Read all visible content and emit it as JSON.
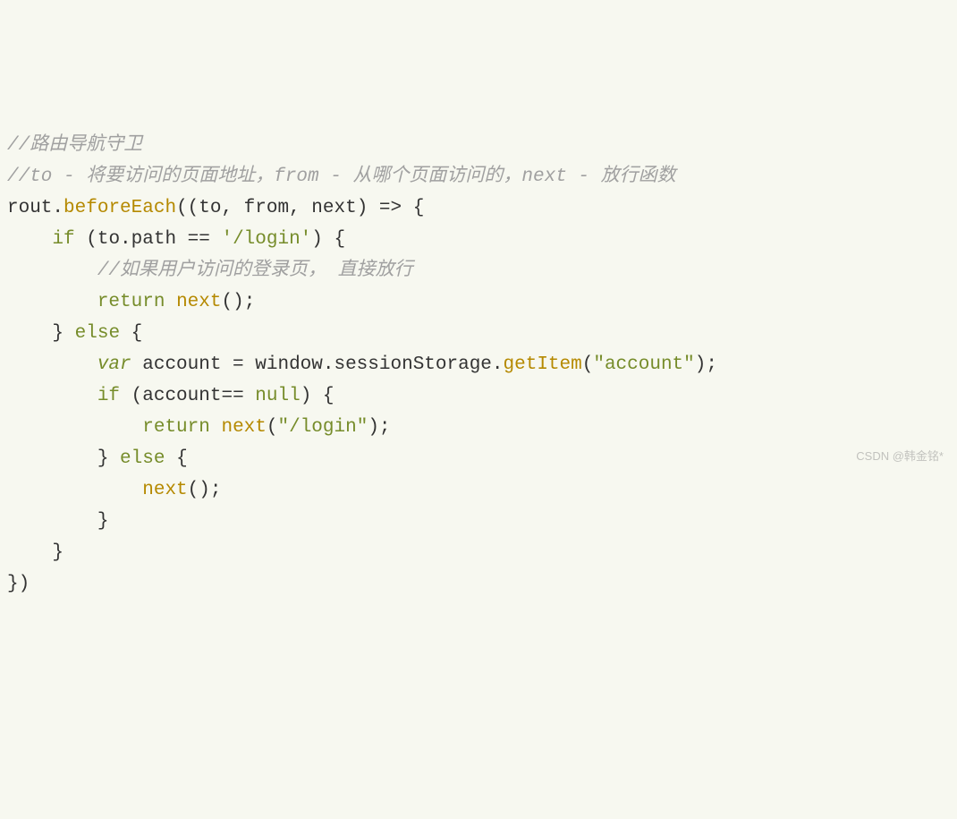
{
  "code": {
    "line1_comment": "//路由导航守卫",
    "line2_comment": "//to - 将要访问的页面地址，from - 从哪个页面访问的，next - 放行函数",
    "line3_obj": "rout",
    "line3_method": "beforeEach",
    "line3_params_open": "((to, from, next) ",
    "line3_arrow": "=>",
    "line3_brace": " {",
    "line4_indent": "    ",
    "line4_if": "if",
    "line4_cond": " (to.path == ",
    "line4_string": "'/login'",
    "line4_close": ") {",
    "line5_indent": "        ",
    "line5_comment": "//如果用户访问的登录页， 直接放行",
    "line6_indent": "        ",
    "line6_return": "return",
    "line6_space": " ",
    "line6_next": "next",
    "line6_call": "();",
    "line7_indent": "    ",
    "line7_brace": "} ",
    "line7_else": "else",
    "line7_open": " {",
    "line8_indent": "        ",
    "line8_var": "var",
    "line8_decl": " account = window.sessionStorage.",
    "line8_method": "getItem",
    "line8_open": "(",
    "line8_string": "\"account\"",
    "line8_close": ");",
    "line9_indent": "        ",
    "line9_if": "if",
    "line9_cond": " (account== ",
    "line9_null": "null",
    "line9_close": ") {",
    "line10_indent": "            ",
    "line10_return": "return",
    "line10_space": " ",
    "line10_next": "next",
    "line10_open": "(",
    "line10_string": "\"/login\"",
    "line10_close": ");",
    "line11_indent": "        ",
    "line11_brace": "} ",
    "line11_else": "else",
    "line11_open": " {",
    "line12_indent": "            ",
    "line12_next": "next",
    "line12_call": "();",
    "line13_indent": "        ",
    "line13_brace": "}",
    "line14_indent": "    ",
    "line14_brace": "}",
    "line15_close": "})"
  },
  "watermark": "CSDN @韩金铭*"
}
